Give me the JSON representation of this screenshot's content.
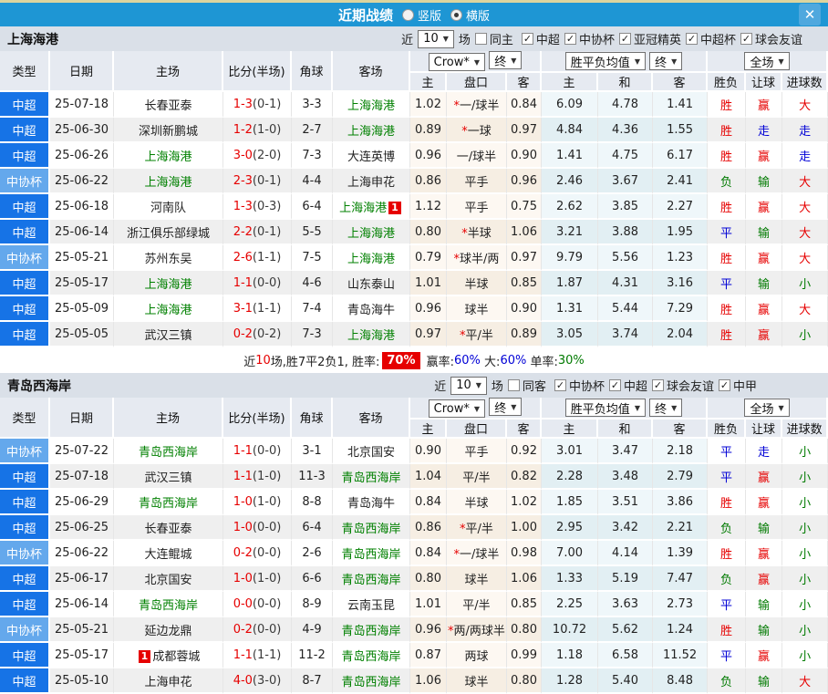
{
  "icons": {
    "dropdown_arrow": "▼",
    "close": "✕",
    "check": "✓"
  },
  "colors": {
    "titlebar_blue": "#1E96D4",
    "type_league_blue": "#1673E6",
    "type_cup_blue": "#64A8EC",
    "win_red": "#E60000",
    "lose_green": "#007A00",
    "draw_blue": "#0000D6",
    "team_green": "#008000"
  },
  "titlebar": {
    "title": "近期战绩",
    "vertical": "竖版",
    "horizontal": "横版"
  },
  "table_header": {
    "cols": [
      "类型",
      "日期",
      "主场",
      "比分(半场)",
      "角球",
      "客场"
    ],
    "sub": [
      "主",
      "盘口",
      "客",
      "主",
      "和",
      "客",
      "胜负",
      "让球",
      "进球数"
    ],
    "crow": "Crow*",
    "final": "终",
    "avg": "胜平负均值",
    "scope": "全场"
  },
  "sections": [
    {
      "team": "上海海港",
      "filter": {
        "near": "近",
        "games": "10",
        "unit": "场",
        "same": "同主",
        "same_checked": false,
        "leagues": [
          "中超",
          "中协杯",
          "亚冠精英",
          "中超杯",
          "球会友谊"
        ]
      },
      "rows": [
        {
          "t": "中超",
          "d": "25-07-18",
          "h": "长春亚泰",
          "hg": 0,
          "hb": "",
          "s": "1-3",
          "hf": "(0-1)",
          "c": "3-3",
          "a": "上海海港",
          "ag": 1,
          "ab": "",
          "o1": "1.02",
          "st": 1,
          "hc": "一/球半",
          "o2": "0.84",
          "m1": "6.09",
          "m2": "4.78",
          "m3": "1.41",
          "r1": "胜",
          "c1": "r",
          "r2": "赢",
          "c2": "r",
          "r3": "大",
          "c3": "r"
        },
        {
          "t": "中超",
          "d": "25-06-30",
          "h": "深圳新鹏城",
          "hg": 0,
          "hb": "",
          "s": "1-2",
          "hf": "(1-0)",
          "c": "2-7",
          "a": "上海海港",
          "ag": 1,
          "ab": "",
          "o1": "0.89",
          "st": 1,
          "hc": "一球",
          "o2": "0.97",
          "m1": "4.84",
          "m2": "4.36",
          "m3": "1.55",
          "r1": "胜",
          "c1": "r",
          "r2": "走",
          "c2": "b",
          "r3": "走",
          "c3": "b"
        },
        {
          "t": "中超",
          "d": "25-06-26",
          "h": "上海海港",
          "hg": 1,
          "hb": "",
          "s": "3-0",
          "hf": "(2-0)",
          "c": "7-3",
          "a": "大连英博",
          "ag": 0,
          "ab": "",
          "o1": "0.96",
          "st": 0,
          "hc": "一/球半",
          "o2": "0.90",
          "m1": "1.41",
          "m2": "4.75",
          "m3": "6.17",
          "r1": "胜",
          "c1": "r",
          "r2": "赢",
          "c2": "r",
          "r3": "走",
          "c3": "b"
        },
        {
          "t": "中协杯",
          "d": "25-06-22",
          "h": "上海海港",
          "hg": 1,
          "hb": "",
          "s": "2-3",
          "hf": "(0-1)",
          "c": "4-4",
          "a": "上海申花",
          "ag": 0,
          "ab": "",
          "o1": "0.86",
          "st": 0,
          "hc": "平手",
          "o2": "0.96",
          "m1": "2.46",
          "m2": "3.67",
          "m3": "2.41",
          "r1": "负",
          "c1": "g",
          "r2": "输",
          "c2": "g",
          "r3": "大",
          "c3": "r"
        },
        {
          "t": "中超",
          "d": "25-06-18",
          "h": "河南队",
          "hg": 0,
          "hb": "",
          "s": "1-3",
          "hf": "(0-3)",
          "c": "6-4",
          "a": "上海海港",
          "ag": 1,
          "ab": "1",
          "o1": "1.12",
          "st": 0,
          "hc": "平手",
          "o2": "0.75",
          "m1": "2.62",
          "m2": "3.85",
          "m3": "2.27",
          "r1": "胜",
          "c1": "r",
          "r2": "赢",
          "c2": "r",
          "r3": "大",
          "c3": "r"
        },
        {
          "t": "中超",
          "d": "25-06-14",
          "h": "浙江俱乐部绿城",
          "hg": 0,
          "hb": "",
          "s": "2-2",
          "hf": "(0-1)",
          "c": "5-5",
          "a": "上海海港",
          "ag": 1,
          "ab": "",
          "o1": "0.80",
          "st": 1,
          "hc": "半球",
          "o2": "1.06",
          "m1": "3.21",
          "m2": "3.88",
          "m3": "1.95",
          "r1": "平",
          "c1": "b",
          "r2": "输",
          "c2": "g",
          "r3": "大",
          "c3": "r"
        },
        {
          "t": "中协杯",
          "d": "25-05-21",
          "h": "苏州东吴",
          "hg": 0,
          "hb": "",
          "s": "2-6",
          "hf": "(1-1)",
          "c": "7-5",
          "a": "上海海港",
          "ag": 1,
          "ab": "",
          "o1": "0.79",
          "st": 1,
          "hc": "球半/两",
          "o2": "0.97",
          "m1": "9.79",
          "m2": "5.56",
          "m3": "1.23",
          "r1": "胜",
          "c1": "r",
          "r2": "赢",
          "c2": "r",
          "r3": "大",
          "c3": "r"
        },
        {
          "t": "中超",
          "d": "25-05-17",
          "h": "上海海港",
          "hg": 1,
          "hb": "",
          "s": "1-1",
          "hf": "(0-0)",
          "c": "4-6",
          "a": "山东泰山",
          "ag": 0,
          "ab": "",
          "o1": "1.01",
          "st": 0,
          "hc": "半球",
          "o2": "0.85",
          "m1": "1.87",
          "m2": "4.31",
          "m3": "3.16",
          "r1": "平",
          "c1": "b",
          "r2": "输",
          "c2": "g",
          "r3": "小",
          "c3": "g"
        },
        {
          "t": "中超",
          "d": "25-05-09",
          "h": "上海海港",
          "hg": 1,
          "hb": "",
          "s": "3-1",
          "hf": "(1-1)",
          "c": "7-4",
          "a": "青岛海牛",
          "ag": 0,
          "ab": "",
          "o1": "0.96",
          "st": 0,
          "hc": "球半",
          "o2": "0.90",
          "m1": "1.31",
          "m2": "5.44",
          "m3": "7.29",
          "r1": "胜",
          "c1": "r",
          "r2": "赢",
          "c2": "r",
          "r3": "大",
          "c3": "r"
        },
        {
          "t": "中超",
          "d": "25-05-05",
          "h": "武汉三镇",
          "hg": 0,
          "hb": "",
          "s": "0-2",
          "hf": "(0-2)",
          "c": "7-3",
          "a": "上海海港",
          "ag": 1,
          "ab": "",
          "o1": "0.97",
          "st": 1,
          "hc": "平/半",
          "o2": "0.89",
          "m1": "3.05",
          "m2": "3.74",
          "m3": "2.04",
          "r1": "胜",
          "c1": "r",
          "r2": "赢",
          "c2": "r",
          "r3": "小",
          "c3": "g"
        }
      ],
      "summary": {
        "near": "近",
        "count": "10",
        "text": "场,胜7平2负1, 胜率:",
        "win_rate": "70%",
        "parts": [
          {
            "label": " 赢率:",
            "value": "60%",
            "cls": "b"
          },
          {
            "label": " 大:",
            "value": "60%",
            "cls": "b"
          },
          {
            "label": " 单率:",
            "value": "30%",
            "cls": "g"
          }
        ]
      }
    },
    {
      "team": "青岛西海岸",
      "filter": {
        "near": "近",
        "games": "10",
        "unit": "场",
        "same": "同客",
        "same_checked": false,
        "leagues": [
          "中协杯",
          "中超",
          "球会友谊",
          "中甲"
        ]
      },
      "rows": [
        {
          "t": "中协杯",
          "d": "25-07-22",
          "h": "青岛西海岸",
          "hg": 1,
          "hb": "",
          "s": "1-1",
          "hf": "(0-0)",
          "c": "3-1",
          "a": "北京国安",
          "ag": 0,
          "ab": "",
          "o1": "0.90",
          "st": 0,
          "hc": "平手",
          "o2": "0.92",
          "m1": "3.01",
          "m2": "3.47",
          "m3": "2.18",
          "r1": "平",
          "c1": "b",
          "r2": "走",
          "c2": "b",
          "r3": "小",
          "c3": "g"
        },
        {
          "t": "中超",
          "d": "25-07-18",
          "h": "武汉三镇",
          "hg": 0,
          "hb": "",
          "s": "1-1",
          "hf": "(1-0)",
          "c": "11-3",
          "a": "青岛西海岸",
          "ag": 1,
          "ab": "",
          "o1": "1.04",
          "st": 0,
          "hc": "平/半",
          "o2": "0.82",
          "m1": "2.28",
          "m2": "3.48",
          "m3": "2.79",
          "r1": "平",
          "c1": "b",
          "r2": "赢",
          "c2": "r",
          "r3": "小",
          "c3": "g"
        },
        {
          "t": "中超",
          "d": "25-06-29",
          "h": "青岛西海岸",
          "hg": 1,
          "hb": "",
          "s": "1-0",
          "hf": "(1-0)",
          "c": "8-8",
          "a": "青岛海牛",
          "ag": 0,
          "ab": "",
          "o1": "0.84",
          "st": 0,
          "hc": "半球",
          "o2": "1.02",
          "m1": "1.85",
          "m2": "3.51",
          "m3": "3.86",
          "r1": "胜",
          "c1": "r",
          "r2": "赢",
          "c2": "r",
          "r3": "小",
          "c3": "g"
        },
        {
          "t": "中超",
          "d": "25-06-25",
          "h": "长春亚泰",
          "hg": 0,
          "hb": "",
          "s": "1-0",
          "hf": "(0-0)",
          "c": "6-4",
          "a": "青岛西海岸",
          "ag": 1,
          "ab": "",
          "o1": "0.86",
          "st": 1,
          "hc": "平/半",
          "o2": "1.00",
          "m1": "2.95",
          "m2": "3.42",
          "m3": "2.21",
          "r1": "负",
          "c1": "g",
          "r2": "输",
          "c2": "g",
          "r3": "小",
          "c3": "g"
        },
        {
          "t": "中协杯",
          "d": "25-06-22",
          "h": "大连鲲城",
          "hg": 0,
          "hb": "",
          "s": "0-2",
          "hf": "(0-0)",
          "c": "2-6",
          "a": "青岛西海岸",
          "ag": 1,
          "ab": "",
          "o1": "0.84",
          "st": 1,
          "hc": "一/球半",
          "o2": "0.98",
          "m1": "7.00",
          "m2": "4.14",
          "m3": "1.39",
          "r1": "胜",
          "c1": "r",
          "r2": "赢",
          "c2": "r",
          "r3": "小",
          "c3": "g"
        },
        {
          "t": "中超",
          "d": "25-06-17",
          "h": "北京国安",
          "hg": 0,
          "hb": "",
          "s": "1-0",
          "hf": "(1-0)",
          "c": "6-6",
          "a": "青岛西海岸",
          "ag": 1,
          "ab": "",
          "o1": "0.80",
          "st": 0,
          "hc": "球半",
          "o2": "1.06",
          "m1": "1.33",
          "m2": "5.19",
          "m3": "7.47",
          "r1": "负",
          "c1": "g",
          "r2": "赢",
          "c2": "r",
          "r3": "小",
          "c3": "g"
        },
        {
          "t": "中超",
          "d": "25-06-14",
          "h": "青岛西海岸",
          "hg": 1,
          "hb": "",
          "s": "0-0",
          "hf": "(0-0)",
          "c": "8-9",
          "a": "云南玉昆",
          "ag": 0,
          "ab": "",
          "o1": "1.01",
          "st": 0,
          "hc": "平/半",
          "o2": "0.85",
          "m1": "2.25",
          "m2": "3.63",
          "m3": "2.73",
          "r1": "平",
          "c1": "b",
          "r2": "输",
          "c2": "g",
          "r3": "小",
          "c3": "g"
        },
        {
          "t": "中协杯",
          "d": "25-05-21",
          "h": "延边龙鼎",
          "hg": 0,
          "hb": "",
          "s": "0-2",
          "hf": "(0-0)",
          "c": "4-9",
          "a": "青岛西海岸",
          "ag": 1,
          "ab": "",
          "o1": "0.96",
          "st": 1,
          "hc": "两/两球半",
          "o2": "0.80",
          "m1": "10.72",
          "m2": "5.62",
          "m3": "1.24",
          "r1": "胜",
          "c1": "r",
          "r2": "输",
          "c2": "g",
          "r3": "小",
          "c3": "g"
        },
        {
          "t": "中超",
          "d": "25-05-17",
          "h": "成都蓉城",
          "hg": 0,
          "hb": "1",
          "s": "1-1",
          "hf": "(1-1)",
          "c": "11-2",
          "a": "青岛西海岸",
          "ag": 1,
          "ab": "",
          "o1": "0.87",
          "st": 0,
          "hc": "两球",
          "o2": "0.99",
          "m1": "1.18",
          "m2": "6.58",
          "m3": "11.52",
          "r1": "平",
          "c1": "b",
          "r2": "赢",
          "c2": "r",
          "r3": "小",
          "c3": "g"
        },
        {
          "t": "中超",
          "d": "25-05-10",
          "h": "上海申花",
          "hg": 0,
          "hb": "",
          "s": "4-0",
          "hf": "(3-0)",
          "c": "8-7",
          "a": "青岛西海岸",
          "ag": 1,
          "ab": "",
          "o1": "1.06",
          "st": 0,
          "hc": "球半",
          "o2": "0.80",
          "m1": "1.28",
          "m2": "5.40",
          "m3": "8.48",
          "r1": "负",
          "c1": "g",
          "r2": "输",
          "c2": "g",
          "r3": "大",
          "c3": "r"
        }
      ]
    }
  ]
}
